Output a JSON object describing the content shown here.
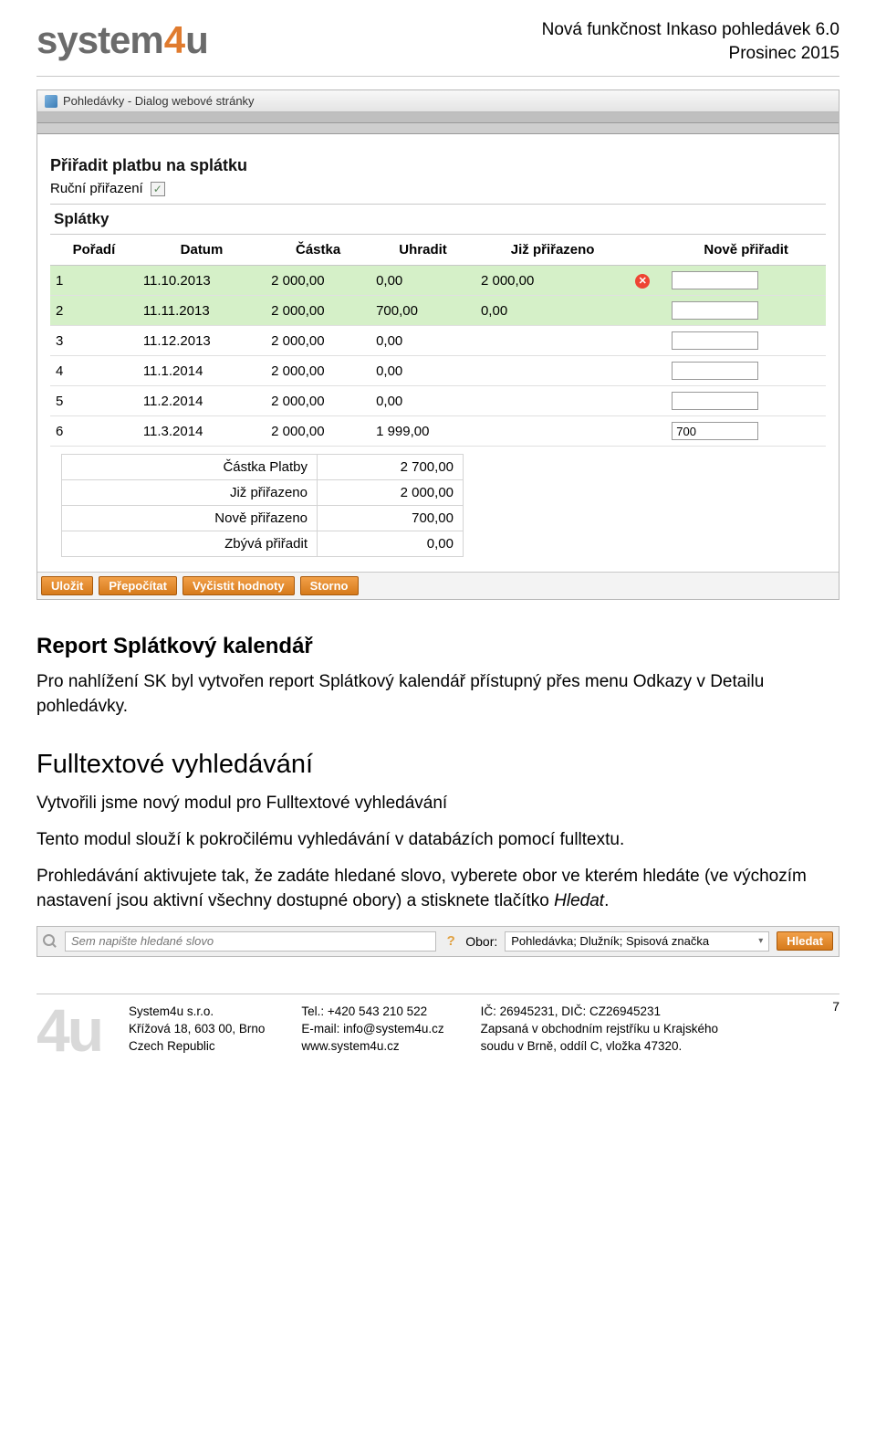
{
  "header": {
    "logo_text_1": "system",
    "logo_text_2": "4",
    "logo_text_3": "u",
    "title_line1": "Nová funkčnost Inkaso pohledávek 6.0",
    "title_line2": "Prosinec 2015"
  },
  "dialog": {
    "titlebar": "Pohledávky - Dialog webové stránky",
    "heading": "Přiřadit platbu na splátku",
    "manual_label": "Ruční přiřazení",
    "section_label": "Splátky",
    "columns": {
      "poradi": "Pořadí",
      "datum": "Datum",
      "castka": "Částka",
      "uhradit": "Uhradit",
      "jiz": "Již přiřazeno",
      "nove": "Nově přiřadit"
    },
    "rows": [
      {
        "poradi": "1",
        "datum": "11.10.2013",
        "castka": "2 000,00",
        "uhradit": "0,00",
        "jiz": "2 000,00",
        "del": true,
        "nove": "",
        "hl": true
      },
      {
        "poradi": "2",
        "datum": "11.11.2013",
        "castka": "2 000,00",
        "uhradit": "700,00",
        "jiz": "0,00",
        "del": false,
        "nove": "",
        "hl": true
      },
      {
        "poradi": "3",
        "datum": "11.12.2013",
        "castka": "2 000,00",
        "uhradit": "0,00",
        "jiz": "",
        "del": false,
        "nove": "",
        "hl": false
      },
      {
        "poradi": "4",
        "datum": "11.1.2014",
        "castka": "2 000,00",
        "uhradit": "0,00",
        "jiz": "",
        "del": false,
        "nove": "",
        "hl": false
      },
      {
        "poradi": "5",
        "datum": "11.2.2014",
        "castka": "2 000,00",
        "uhradit": "0,00",
        "jiz": "",
        "del": false,
        "nove": "",
        "hl": false
      },
      {
        "poradi": "6",
        "datum": "11.3.2014",
        "castka": "2 000,00",
        "uhradit": "1 999,00",
        "jiz": "",
        "del": false,
        "nove": "700",
        "hl": false
      }
    ],
    "summary": [
      {
        "label": "Částka Platby",
        "value": "2 700,00"
      },
      {
        "label": "Již přiřazeno",
        "value": "2 000,00"
      },
      {
        "label": "Nově přiřazeno",
        "value": "700,00"
      },
      {
        "label": "Zbývá přiřadit",
        "value": "0,00"
      }
    ],
    "buttons": {
      "save": "Uložit",
      "recalc": "Přepočítat",
      "clear": "Vyčistit hodnoty",
      "storno": "Storno"
    }
  },
  "text": {
    "section1_title": "Report Splátkový kalendář",
    "section1_body": "Pro nahlížení SK byl vytvořen report Splátkový kalendář přístupný přes menu Odkazy v Detailu pohledávky.",
    "section2_title": "Fulltextové vyhledávání",
    "section2_intro": "Vytvořili jsme nový modul pro Fulltextové vyhledávání",
    "section2_p1": "Tento modul slouží k pokročilému vyhledávání v databázích pomocí fulltextu.",
    "section2_p2a": "Prohledávání aktivujete tak, že zadáte hledané slovo, vyberete obor ve kterém hledáte (ve výchozím nastavení jsou aktivní všechny dostupné obory) a stisknete tlačítko ",
    "section2_p2b": "Hledat",
    "section2_p2c": "."
  },
  "searchbar": {
    "placeholder": "Sem napište hledané slovo",
    "obor_label": "Obor:",
    "obor_value": "Pohledávka; Dlužník; Spisová značka",
    "button": "Hledat"
  },
  "footer": {
    "col1": {
      "l1": "System4u s.r.o.",
      "l2": "Křížová 18, 603 00, Brno",
      "l3": "Czech Republic"
    },
    "col2": {
      "l1": "Tel.: +420 543 210 522",
      "l2": "E-mail: info@system4u.cz",
      "l3": "www.system4u.cz"
    },
    "col3": {
      "l1": "IČ: 26945231, DIČ: CZ26945231",
      "l2": "Zapsaná v obchodním rejstříku u Krajského",
      "l3": "soudu v Brně, oddíl C, vložka 47320."
    },
    "page": "7"
  }
}
